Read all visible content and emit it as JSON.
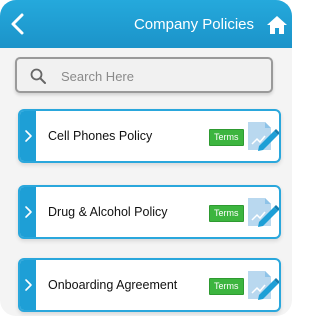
{
  "header": {
    "title": "Company Policies",
    "back_icon": "chevron-left-icon",
    "home_icon": "home-icon"
  },
  "search": {
    "placeholder": "Search Here",
    "value": "",
    "icon": "search-icon"
  },
  "policies": [
    {
      "title": "Cell Phones Policy",
      "badge": "Terms"
    },
    {
      "title": "Drug & Alcohol Policy",
      "badge": "Terms"
    },
    {
      "title": "Onboarding Agreement",
      "badge": "Terms"
    }
  ],
  "colors": {
    "header": "#1e9fd6",
    "card_border": "#2aa7dc",
    "badge": "#3cb53f",
    "background": "#f4f4f4"
  }
}
